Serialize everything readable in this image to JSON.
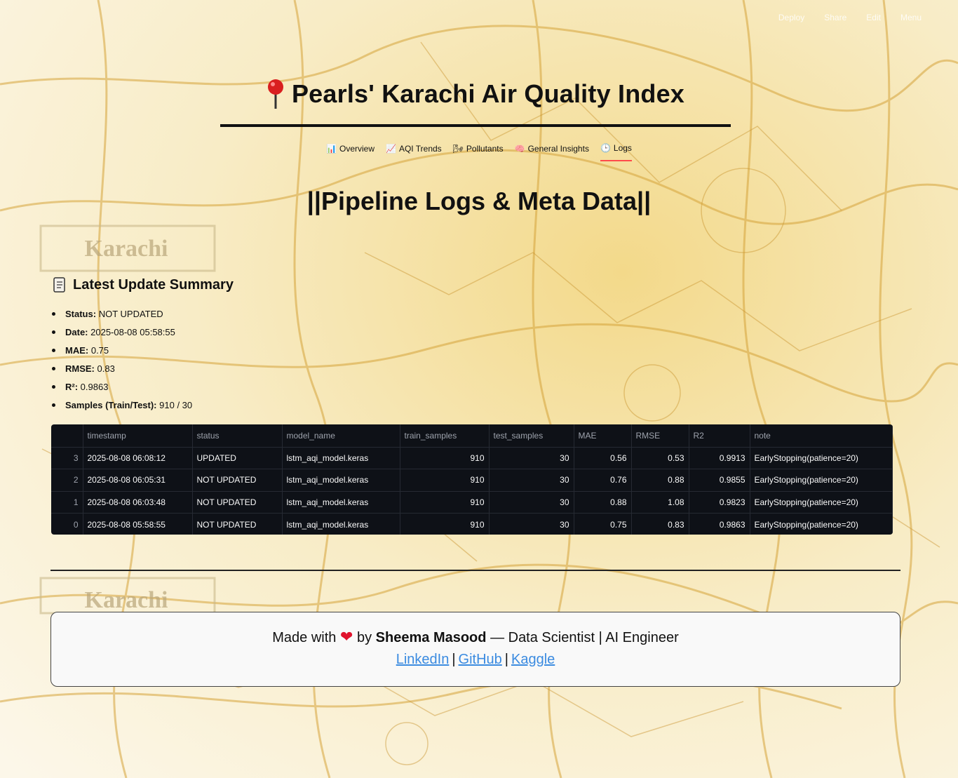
{
  "topmenu": [
    "Deploy",
    "Share",
    "Edit",
    "Menu"
  ],
  "title": {
    "icon": "pushpin-icon",
    "text": "Pearls' Karachi Air Quality Index"
  },
  "nav": [
    {
      "icon": "bar-chart-icon",
      "glyph": "📊",
      "label": "Overview"
    },
    {
      "icon": "line-chart-icon",
      "glyph": "📈",
      "label": "AQI Trends"
    },
    {
      "icon": "wind-icon",
      "glyph": "🌬",
      "label": "Pollutants"
    },
    {
      "icon": "brain-icon",
      "glyph": "🧠",
      "label": "General Insights"
    },
    {
      "icon": "clock-icon",
      "glyph": "🕒",
      "label": "Logs",
      "active": true
    }
  ],
  "section_title": "||Pipeline Logs & Meta Data||",
  "summary": {
    "icon": "scroll-icon",
    "heading": "Latest Update Summary",
    "items": [
      {
        "label": "Status:",
        "value": "NOT UPDATED"
      },
      {
        "label": "Date:",
        "value": "2025-08-08 05:58:55"
      },
      {
        "label": "MAE:",
        "value": "0.75"
      },
      {
        "label": "RMSE:",
        "value": "0.83"
      },
      {
        "label": "R²:",
        "value": "0.9863"
      },
      {
        "label": "Samples (Train/Test):",
        "value": "910 / 30"
      }
    ]
  },
  "table": {
    "columns": [
      "",
      "timestamp",
      "status",
      "model_name",
      "train_samples",
      "test_samples",
      "MAE",
      "RMSE",
      "R2",
      "note"
    ],
    "rows": [
      [
        "3",
        "2025-08-08 06:08:12",
        "UPDATED",
        "lstm_aqi_model.keras",
        "910",
        "30",
        "0.56",
        "0.53",
        "0.9913",
        "EarlyStopping(patience=20)"
      ],
      [
        "2",
        "2025-08-08 06:05:31",
        "NOT UPDATED",
        "lstm_aqi_model.keras",
        "910",
        "30",
        "0.76",
        "0.88",
        "0.9855",
        "EarlyStopping(patience=20)"
      ],
      [
        "1",
        "2025-08-08 06:03:48",
        "NOT UPDATED",
        "lstm_aqi_model.keras",
        "910",
        "30",
        "0.88",
        "1.08",
        "0.9823",
        "EarlyStopping(patience=20)"
      ],
      [
        "0",
        "2025-08-08 05:58:55",
        "NOT UPDATED",
        "lstm_aqi_model.keras",
        "910",
        "30",
        "0.75",
        "0.83",
        "0.9863",
        "EarlyStopping(patience=20)"
      ]
    ]
  },
  "footer": {
    "made_with": "Made with",
    "heart": "❤",
    "by": "by",
    "author": "Sheema Masood",
    "role": "— Data Scientist | AI Engineer",
    "links": [
      "LinkedIn",
      "GitHub",
      "Kaggle"
    ],
    "separator": "|"
  },
  "colors": {
    "accent": "#ff4b4b",
    "table_bg": "#0e1117",
    "link": "#3b8be0",
    "map_gold": "#d9a83a"
  }
}
